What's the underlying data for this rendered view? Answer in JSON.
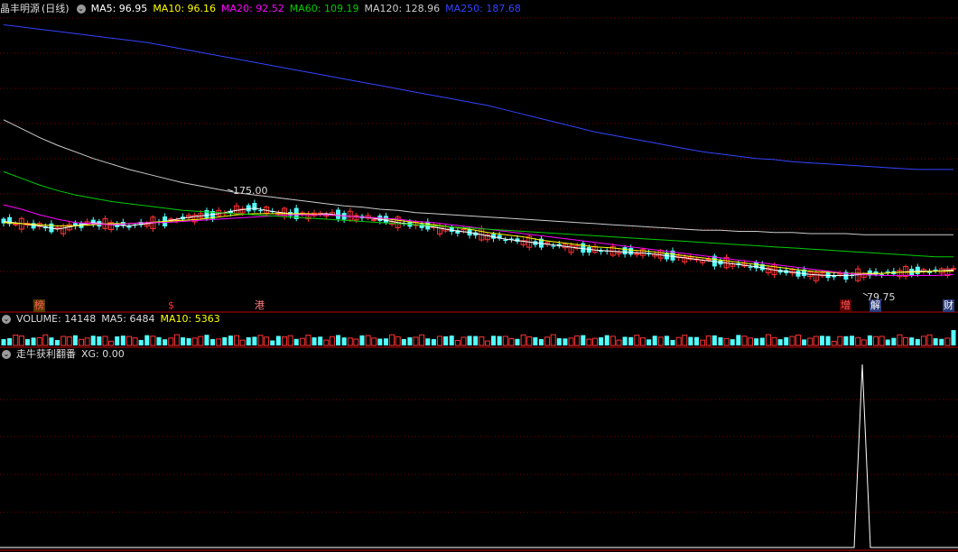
{
  "stock": {
    "name": "晶丰明源",
    "period": "(日线)"
  },
  "ma_legend": [
    {
      "label": "MA5: 96.95",
      "color": "#ffffff"
    },
    {
      "label": "MA10: 96.16",
      "color": "#ffff00"
    },
    {
      "label": "MA20: 92.52",
      "color": "#ff00ff"
    },
    {
      "label": "MA60: 109.19",
      "color": "#00cc00"
    },
    {
      "label": "MA120: 128.96",
      "color": "#cccccc"
    },
    {
      "label": "MA250: 187.68",
      "color": "#3344ff"
    }
  ],
  "volume_legend": [
    {
      "label": "VOLUME: 14148",
      "color": "#dddddd"
    },
    {
      "label": "MA5: 6484",
      "color": "#dddddd"
    },
    {
      "label": "MA10: 5363",
      "color": "#ffff00"
    }
  ],
  "indicator_legend": [
    {
      "label": "走牛获利翻番",
      "color": "#dddddd"
    },
    {
      "label": "XG: 0.00",
      "color": "#dddddd"
    }
  ],
  "price_annotations": {
    "high": "175.00",
    "low": "79.75"
  },
  "events": [
    {
      "text": "榜",
      "color": "#ff6060",
      "bg": "#5a3a00"
    },
    {
      "text": "$",
      "color": "#ff3030",
      "bg": "transparent"
    },
    {
      "text": "港",
      "color": "#ff8080",
      "bg": "transparent"
    },
    {
      "text": "增",
      "color": "#ff6060",
      "bg": "#5a0000"
    },
    {
      "text": "解",
      "color": "#ffffff",
      "bg": "#2a3a7a"
    },
    {
      "text": "财",
      "color": "#ffffff",
      "bg": "#2a3a7a"
    }
  ],
  "colors": {
    "up": "#ff3232",
    "down": "#54ffff",
    "grid": "#7a0000",
    "panel_border": "#c00000"
  },
  "chart_data": {
    "type": "line",
    "title": "晶丰明源 (日线)",
    "series": [
      {
        "name": "MA5",
        "values": [
          141,
          139,
          137,
          134,
          137,
          140,
          138,
          137,
          139,
          141,
          144,
          146,
          148,
          151,
          153,
          150,
          148,
          147,
          148,
          146,
          145,
          143,
          140,
          138,
          136,
          133,
          131,
          128,
          125,
          123,
          121,
          119,
          117,
          115,
          114,
          113,
          112,
          110,
          108,
          106,
          104,
          102,
          100,
          97,
          95,
          93,
          92,
          92,
          93,
          94,
          95,
          96,
          96,
          97
        ]
      },
      {
        "name": "MA10",
        "values": [
          140,
          139,
          138,
          137,
          137,
          138,
          139,
          139,
          140,
          141,
          142,
          143,
          145,
          147,
          148,
          148,
          148,
          148,
          147,
          146,
          145,
          144,
          142,
          140,
          138,
          136,
          134,
          131,
          129,
          127,
          124,
          122,
          120,
          118,
          117,
          115,
          114,
          112,
          110,
          108,
          106,
          104,
          102,
          100,
          98,
          96,
          95,
          94,
          94,
          94,
          95,
          95,
          96,
          96
        ]
      },
      {
        "name": "MA20",
        "values": [
          156,
          152,
          147,
          143,
          140,
          139,
          138,
          139,
          140,
          140,
          141,
          142,
          143,
          144,
          145,
          146,
          147,
          147,
          147,
          146,
          145,
          144,
          143,
          141,
          140,
          138,
          136,
          134,
          132,
          130,
          128,
          126,
          124,
          122,
          120,
          118,
          116,
          114,
          112,
          110,
          108,
          106,
          104,
          102,
          100,
          98,
          96,
          94,
          93,
          92,
          92,
          92,
          92,
          93
        ]
      },
      {
        "name": "MA60",
        "values": [
          186,
          180,
          174,
          169,
          165,
          162,
          159,
          157,
          155,
          153,
          151,
          150,
          149,
          148,
          147,
          146,
          145,
          144,
          143,
          142,
          141,
          140,
          139,
          138,
          137,
          136,
          135,
          134,
          133,
          132,
          131,
          130,
          129,
          128,
          127,
          126,
          125,
          124,
          123,
          122,
          121,
          120,
          119,
          118,
          117,
          116,
          115,
          114,
          113,
          112,
          111,
          110,
          109,
          109
        ]
      },
      {
        "name": "MA120",
        "values": [
          233,
          225,
          217,
          210,
          204,
          198,
          193,
          188,
          184,
          180,
          176,
          173,
          170,
          167,
          165,
          163,
          161,
          159,
          157,
          155,
          154,
          152,
          151,
          149,
          148,
          147,
          146,
          145,
          144,
          143,
          142,
          141,
          140,
          139,
          138,
          137,
          136,
          135,
          134,
          133,
          133,
          132,
          132,
          131,
          131,
          130,
          130,
          130,
          129,
          129,
          129,
          129,
          129,
          129
        ]
      },
      {
        "name": "MA250",
        "values": [
          319,
          317,
          315,
          313,
          311,
          309,
          307,
          305,
          303,
          300,
          297,
          294,
          291,
          288,
          285,
          282,
          279,
          276,
          273,
          270,
          267,
          264,
          261,
          258,
          255,
          252,
          249,
          246,
          242,
          238,
          234,
          230,
          226,
          222,
          219,
          216,
          213,
          210,
          207,
          204,
          202,
          200,
          198,
          197,
          195,
          194,
          193,
          192,
          191,
          190,
          189,
          188,
          188,
          188
        ]
      }
    ],
    "xg_signal": [
      0,
      0,
      0,
      0,
      0,
      0,
      0,
      0,
      0,
      0,
      0,
      0,
      0,
      0,
      0,
      0,
      0,
      0,
      0,
      0,
      0,
      0,
      0,
      0,
      0,
      0,
      0,
      0,
      0,
      0,
      0,
      0,
      0,
      0,
      0,
      0,
      0,
      0,
      0,
      0,
      0,
      0,
      0,
      0,
      0,
      0,
      0,
      0,
      0,
      1,
      0,
      0,
      0,
      0
    ]
  }
}
